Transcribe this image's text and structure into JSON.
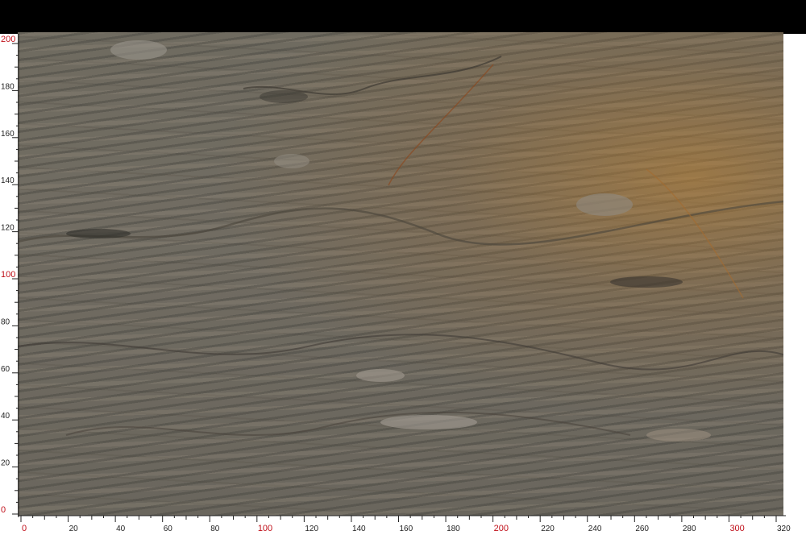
{
  "image": {
    "subject": "stone slab",
    "colors": {
      "background": "#000000",
      "slab_base": "#6f6b60",
      "rust_accent": "#b98235",
      "ruler_major": "#c0101a",
      "ruler_minor": "#222222"
    }
  },
  "rulers": {
    "vertical_labels": [
      "0",
      "20",
      "40",
      "60",
      "80",
      "100",
      "120",
      "140",
      "160",
      "180",
      "200"
    ],
    "horizontal_labels": [
      "0",
      "20",
      "40",
      "60",
      "80",
      "100",
      "120",
      "140",
      "160",
      "180",
      "200",
      "220",
      "240",
      "260",
      "280",
      "300",
      "320"
    ],
    "major_labels": [
      "0",
      "100",
      "200",
      "300"
    ]
  }
}
